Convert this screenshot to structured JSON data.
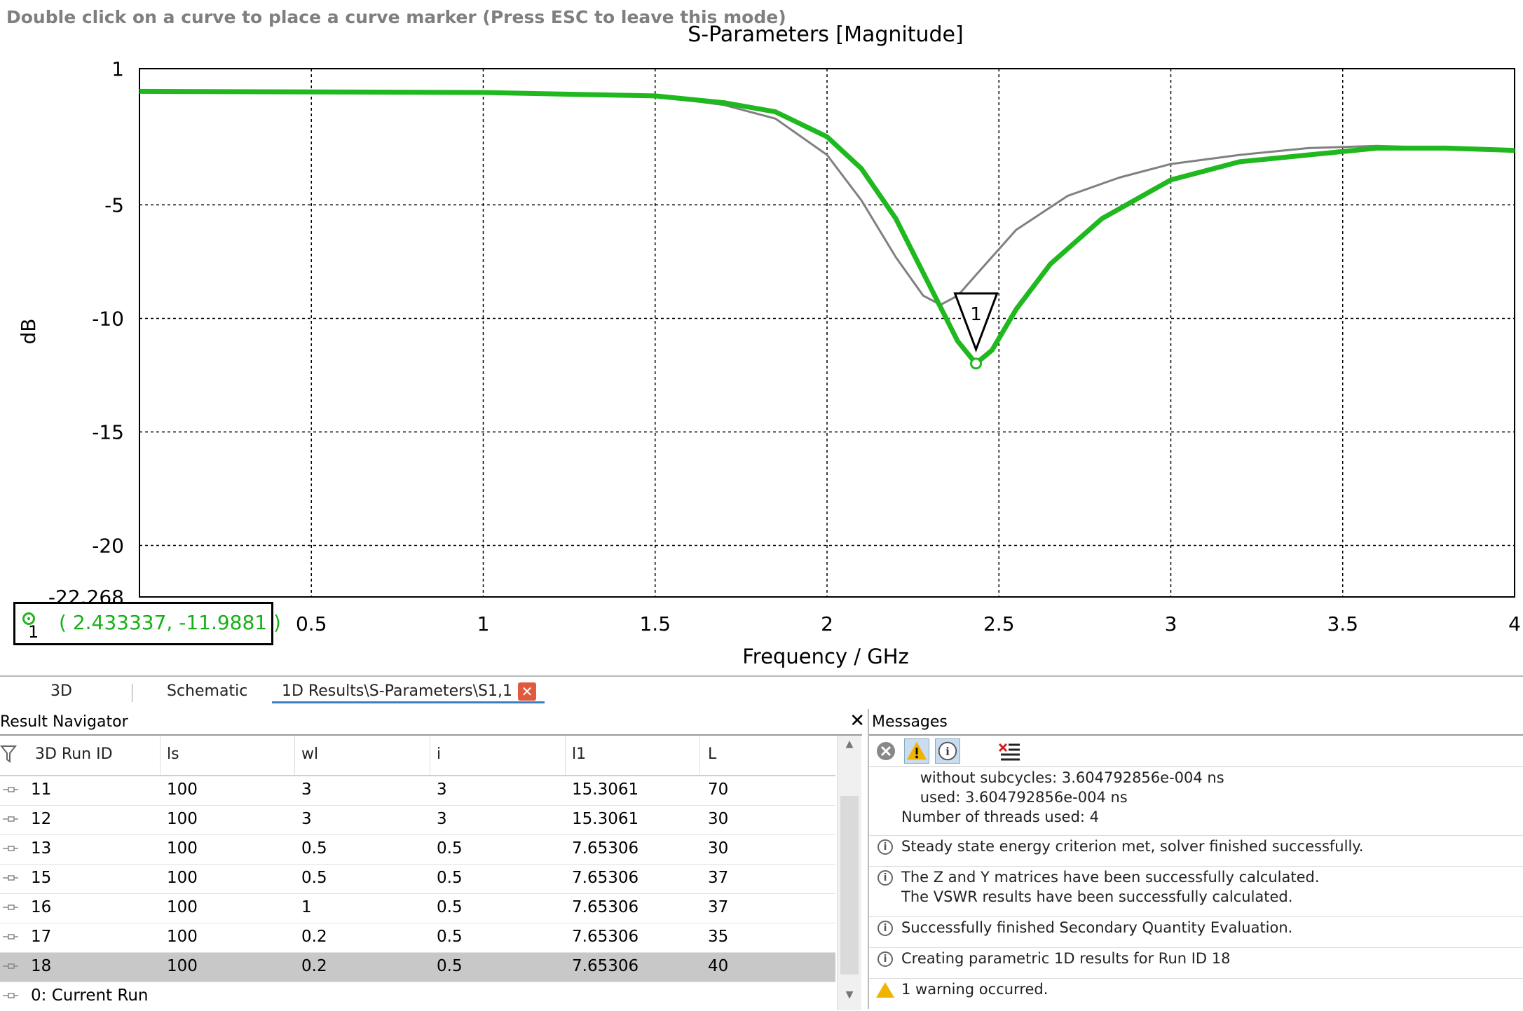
{
  "hint": "Double click on a curve to place a curve marker (Press ESC to leave this mode)",
  "chart_data": {
    "type": "line",
    "title": "S-Parameters [Magnitude]",
    "xlabel": "Frequency / GHz",
    "ylabel": "dB",
    "xlim": [
      0,
      4
    ],
    "ylim": [
      -22.268,
      1
    ],
    "x_ticks": [
      "0.5",
      "1",
      "1.5",
      "2",
      "2.5",
      "3",
      "3.5",
      "4"
    ],
    "y_ticks": [
      "1",
      "-5",
      "-10",
      "-15",
      "-20",
      "-22.268"
    ],
    "grid": true,
    "series": [
      {
        "color": "#808080",
        "x": [
          0,
          1.0,
          1.5,
          1.7,
          1.85,
          2.0,
          2.1,
          2.2,
          2.28,
          2.33,
          2.38,
          2.45,
          2.55,
          2.7,
          2.85,
          3.0,
          3.2,
          3.4,
          3.6,
          3.8,
          4.0
        ],
        "y": [
          0.0,
          -0.05,
          -0.2,
          -0.6,
          -1.2,
          -2.8,
          -4.8,
          -7.3,
          -9.0,
          -9.4,
          -9.0,
          -7.8,
          -6.1,
          -4.6,
          -3.8,
          -3.2,
          -2.8,
          -2.5,
          -2.4,
          -2.5,
          -2.6
        ]
      },
      {
        "color": "#1fb81f",
        "x": [
          0,
          1.0,
          1.5,
          1.7,
          1.85,
          2.0,
          2.1,
          2.2,
          2.3,
          2.38,
          2.433,
          2.48,
          2.55,
          2.65,
          2.8,
          3.0,
          3.2,
          3.4,
          3.6,
          3.8,
          4.0
        ],
        "y": [
          0.0,
          -0.05,
          -0.2,
          -0.5,
          -0.9,
          -2.0,
          -3.4,
          -5.6,
          -8.6,
          -11.0,
          -11.988,
          -11.4,
          -9.6,
          -7.6,
          -5.6,
          -3.9,
          -3.1,
          -2.8,
          -2.5,
          -2.5,
          -2.6
        ]
      }
    ],
    "marker": {
      "label": "1",
      "x": 2.433337,
      "y": -11.9881
    }
  },
  "readout": {
    "number": "1",
    "value": "( 2.433337, -11.9881 )"
  },
  "tabs": [
    "3D",
    "Schematic",
    "1D Results\\S-Parameters\\S1,1"
  ],
  "navigator": {
    "title": "Result Navigator",
    "columns": [
      "3D Run ID",
      "ls",
      "wl",
      "i",
      "l1",
      "L"
    ],
    "rows": [
      [
        "11",
        "100",
        "3",
        "3",
        "15.3061",
        "70"
      ],
      [
        "12",
        "100",
        "3",
        "3",
        "15.3061",
        "30"
      ],
      [
        "13",
        "100",
        "0.5",
        "0.5",
        "7.65306",
        "30"
      ],
      [
        "15",
        "100",
        "0.5",
        "0.5",
        "7.65306",
        "37"
      ],
      [
        "16",
        "100",
        "1",
        "0.5",
        "7.65306",
        "37"
      ],
      [
        "17",
        "100",
        "0.2",
        "0.5",
        "7.65306",
        "35"
      ],
      [
        "18",
        "100",
        "0.2",
        "0.5",
        "7.65306",
        "40"
      ]
    ],
    "selected_row": "18",
    "current_run": "0: Current Run"
  },
  "messages": {
    "title": "Messages",
    "lines": [
      {
        "type": "text",
        "text": "    without subcycles: 3.604792856e-004 ns"
      },
      {
        "type": "text",
        "text": "    used: 3.604792856e-004 ns"
      },
      {
        "type": "text",
        "text": "Number of threads used: 4"
      },
      {
        "type": "info",
        "text": "Steady state energy criterion met, solver finished successfully."
      },
      {
        "type": "info",
        "text": "The Z and Y matrices have been successfully calculated."
      },
      {
        "type": "text",
        "text": "The VSWR results have been successfully calculated."
      },
      {
        "type": "info",
        "text": "Successfully finished Secondary Quantity Evaluation."
      },
      {
        "type": "info",
        "text": "Creating parametric 1D results for Run ID 18"
      },
      {
        "type": "warning",
        "text": "1 warning occurred."
      }
    ]
  }
}
